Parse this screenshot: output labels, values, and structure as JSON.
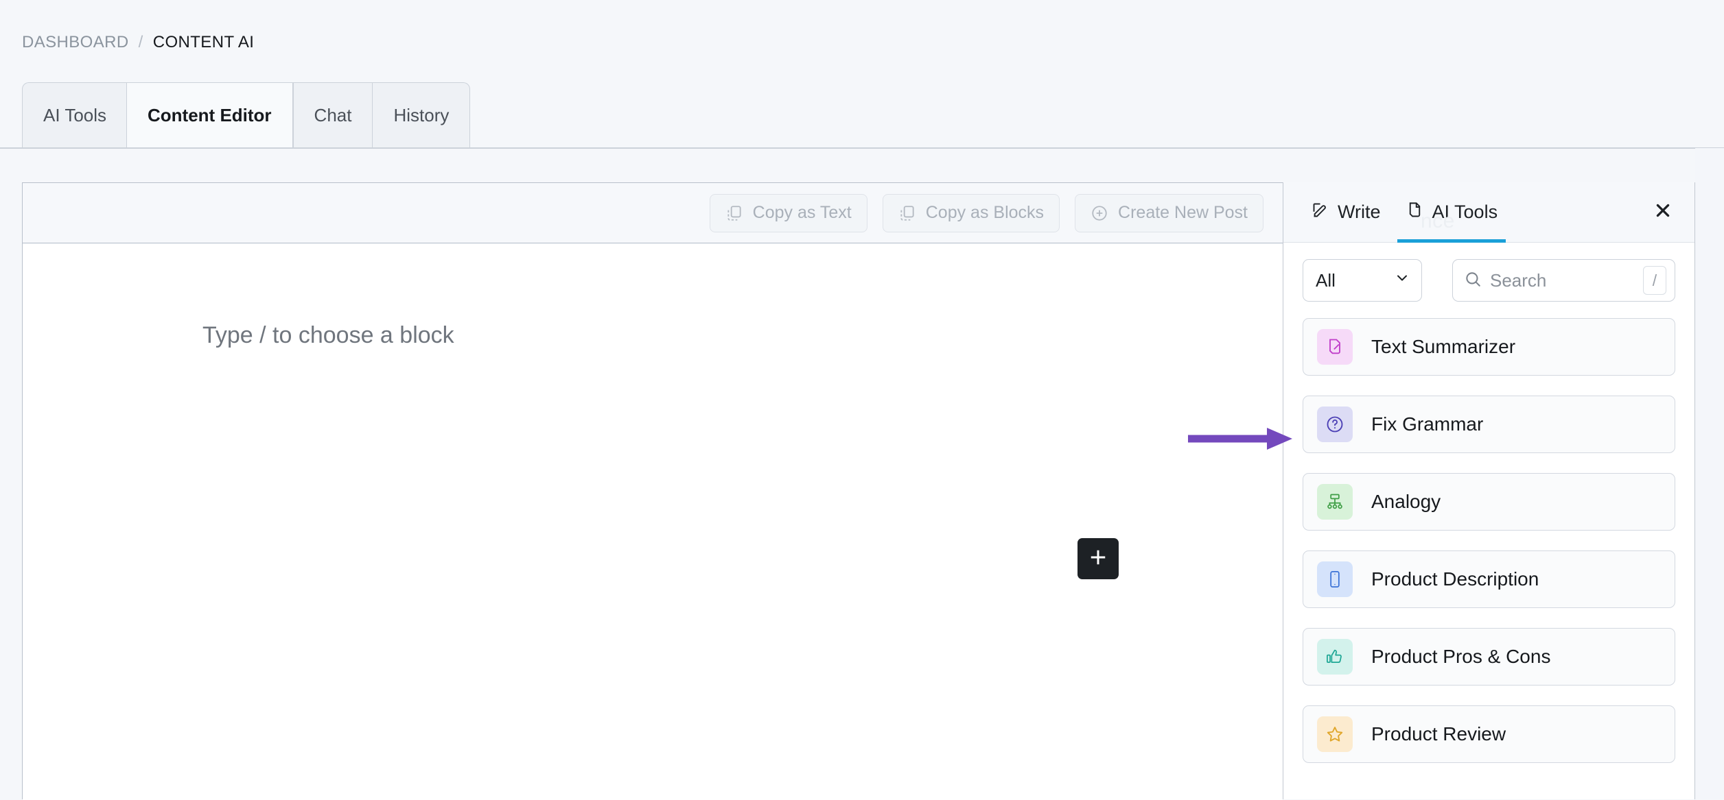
{
  "breadcrumb": {
    "parent": "DASHBOARD",
    "separator": "/",
    "current": "CONTENT AI"
  },
  "tabs": [
    {
      "label": "AI Tools",
      "active": false
    },
    {
      "label": "Content Editor",
      "active": true
    },
    {
      "label": "Chat",
      "active": false
    },
    {
      "label": "History",
      "active": false
    }
  ],
  "editor": {
    "toolbar_buttons": [
      {
        "label": "Copy as Text",
        "icon": "copy-icon",
        "disabled": true
      },
      {
        "label": "Copy as Blocks",
        "icon": "copy-icon",
        "disabled": true
      },
      {
        "label": "Create New Post",
        "icon": "plus-circle-icon",
        "disabled": true
      }
    ],
    "placeholder": "Type / to choose a block",
    "add_block_icon": "plus-icon"
  },
  "side_panel": {
    "tabs": [
      {
        "label": "Write",
        "icon": "pencil-square-icon",
        "active": false
      },
      {
        "label": "AI Tools",
        "icon": "document-icon",
        "active": true
      }
    ],
    "close_icon": "close-icon",
    "filter": {
      "selected": "All",
      "chevron_icon": "chevron-down-icon"
    },
    "ghost_text": "nce",
    "search": {
      "placeholder": "Search",
      "value": "",
      "icon": "search-icon",
      "shortcut_key": "/"
    },
    "tools": [
      {
        "label": "Text Summarizer",
        "icon": "document-pencil-icon",
        "icon_bg": "#f6daf8",
        "icon_color": "#c03ec9"
      },
      {
        "label": "Fix Grammar",
        "icon": "question-circle-icon",
        "icon_bg": "#dcdcf5",
        "icon_color": "#4b3fb5"
      },
      {
        "label": "Analogy",
        "icon": "sitemap-icon",
        "icon_bg": "#d8f2d9",
        "icon_color": "#3f9e46"
      },
      {
        "label": "Product Description",
        "icon": "smartphone-icon",
        "icon_bg": "#d5e3fb",
        "icon_color": "#3b72d6"
      },
      {
        "label": "Product Pros & Cons",
        "icon": "thumbs-up-icon",
        "icon_bg": "#d3f2ec",
        "icon_color": "#1fa795"
      },
      {
        "label": "Product Review",
        "icon": "star-icon",
        "icon_bg": "#fcebcf",
        "icon_color": "#e0a62a"
      }
    ]
  },
  "annotation": {
    "arrow_color": "#7449bd",
    "points_to": "Fix Grammar"
  },
  "colors": {
    "page_bg": "#f5f7fa",
    "accent_blue": "#1aa0d8",
    "active_tab_bg": "#f8fafc",
    "border": "#ccd2da"
  }
}
